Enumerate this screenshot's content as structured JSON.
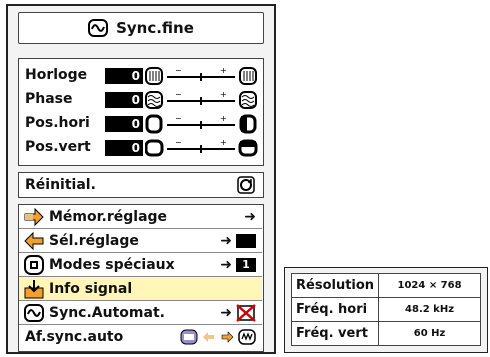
{
  "title": "Sync.fine",
  "adjustments": [
    {
      "label": "Horloge",
      "value": "0",
      "icon": "clock-pattern-icon"
    },
    {
      "label": "Phase",
      "value": "0",
      "icon": "phase-pattern-icon"
    },
    {
      "label": "Pos.hori",
      "value": "0",
      "icon": "horizontal-position-icon"
    },
    {
      "label": "Pos.vert",
      "value": "0",
      "icon": "vertical-position-icon"
    }
  ],
  "slider_marks": {
    "minus": "−",
    "plus": "+"
  },
  "reset": {
    "label": "Réinitial.",
    "icon": "reset-icon"
  },
  "menu": [
    {
      "label": "Mémor.réglage",
      "icon": "save-arrow-icon",
      "arrow": "➜"
    },
    {
      "label": "Sél.réglage",
      "icon": "select-arrow-icon",
      "arrow": "➜"
    },
    {
      "label": "Modes spéciaux",
      "icon": "special-modes-icon",
      "arrow": "➜",
      "badge": "1"
    },
    {
      "label": "Info signal",
      "icon": "signal-info-icon"
    },
    {
      "label": "Sync.Automat.",
      "icon": "auto-sync-icon",
      "arrow": "➜"
    },
    {
      "label": "Af.sync.auto",
      "icon": "auto-sync-display-icon"
    }
  ],
  "signal_info": {
    "rows": [
      {
        "label": "Résolution",
        "value": "1024 × 768"
      },
      {
        "label": "Fréq. hori",
        "value": "48.2 kHz"
      },
      {
        "label": "Fréq. vert",
        "value": "60 Hz"
      }
    ]
  },
  "colors": {
    "highlight": "#fff6b8",
    "panel": "#f3f3f3",
    "value_box": "#000000"
  }
}
